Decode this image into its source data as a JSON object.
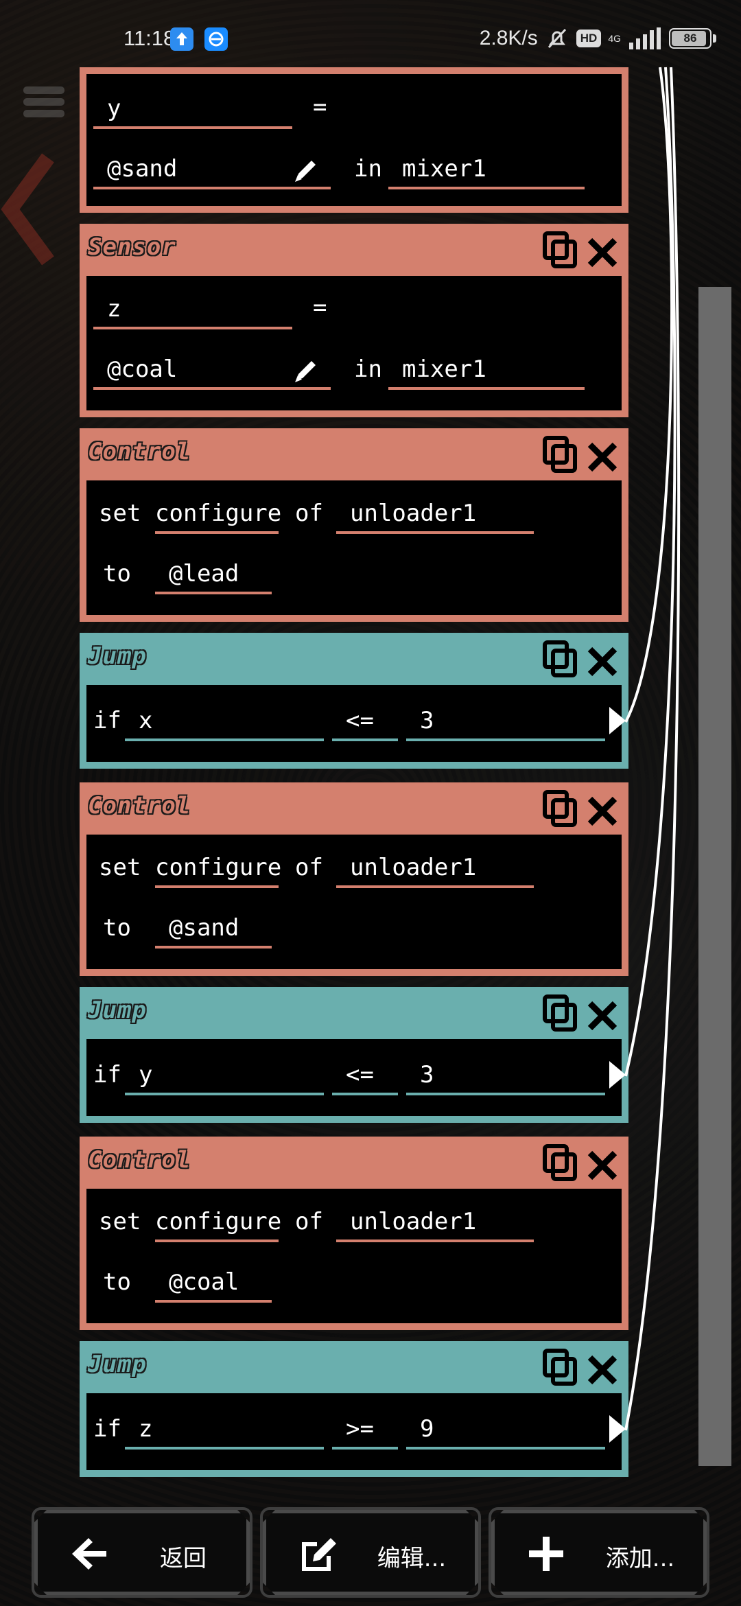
{
  "status_bar": {
    "time": "11:18",
    "net_speed": "2.8K/s",
    "hd_badge": "HD",
    "network": "4G",
    "battery": "86",
    "icons": [
      "upload-icon",
      "browser-icon",
      "mute-bell-icon",
      "signal-icon",
      "battery-icon"
    ]
  },
  "colors": {
    "control": "#d4806e",
    "jump": "#6aafae",
    "background": "#151515"
  },
  "blocks": [
    {
      "type": "sensor-partial",
      "var": "y",
      "eq": "=",
      "item": "@sand",
      "in": "in",
      "target": "mixer1"
    },
    {
      "type": "sensor",
      "title": "Sensor",
      "var": "z",
      "eq": "=",
      "item": "@coal",
      "in": "in",
      "target": "mixer1"
    },
    {
      "type": "control",
      "title": "Control",
      "set": "set",
      "prop": "configure",
      "of": "of",
      "target": "unloader1",
      "to": "to",
      "value": "@lead"
    },
    {
      "type": "jump",
      "title": "Jump",
      "if": "if",
      "a": "x",
      "op": "<=",
      "b": "3"
    },
    {
      "type": "control",
      "title": "Control",
      "set": "set",
      "prop": "configure",
      "of": "of",
      "target": "unloader1",
      "to": "to",
      "value": "@sand"
    },
    {
      "type": "jump",
      "title": "Jump",
      "if": "if",
      "a": "y",
      "op": "<=",
      "b": "3"
    },
    {
      "type": "control",
      "title": "Control",
      "set": "set",
      "prop": "configure",
      "of": "of",
      "target": "unloader1",
      "to": "to",
      "value": "@coal"
    },
    {
      "type": "jump",
      "title": "Jump",
      "if": "if",
      "a": "z",
      "op": ">=",
      "b": "9"
    }
  ],
  "bottom_bar": {
    "back_label": "返回",
    "edit_label": "编辑...",
    "add_label": "添加..."
  }
}
